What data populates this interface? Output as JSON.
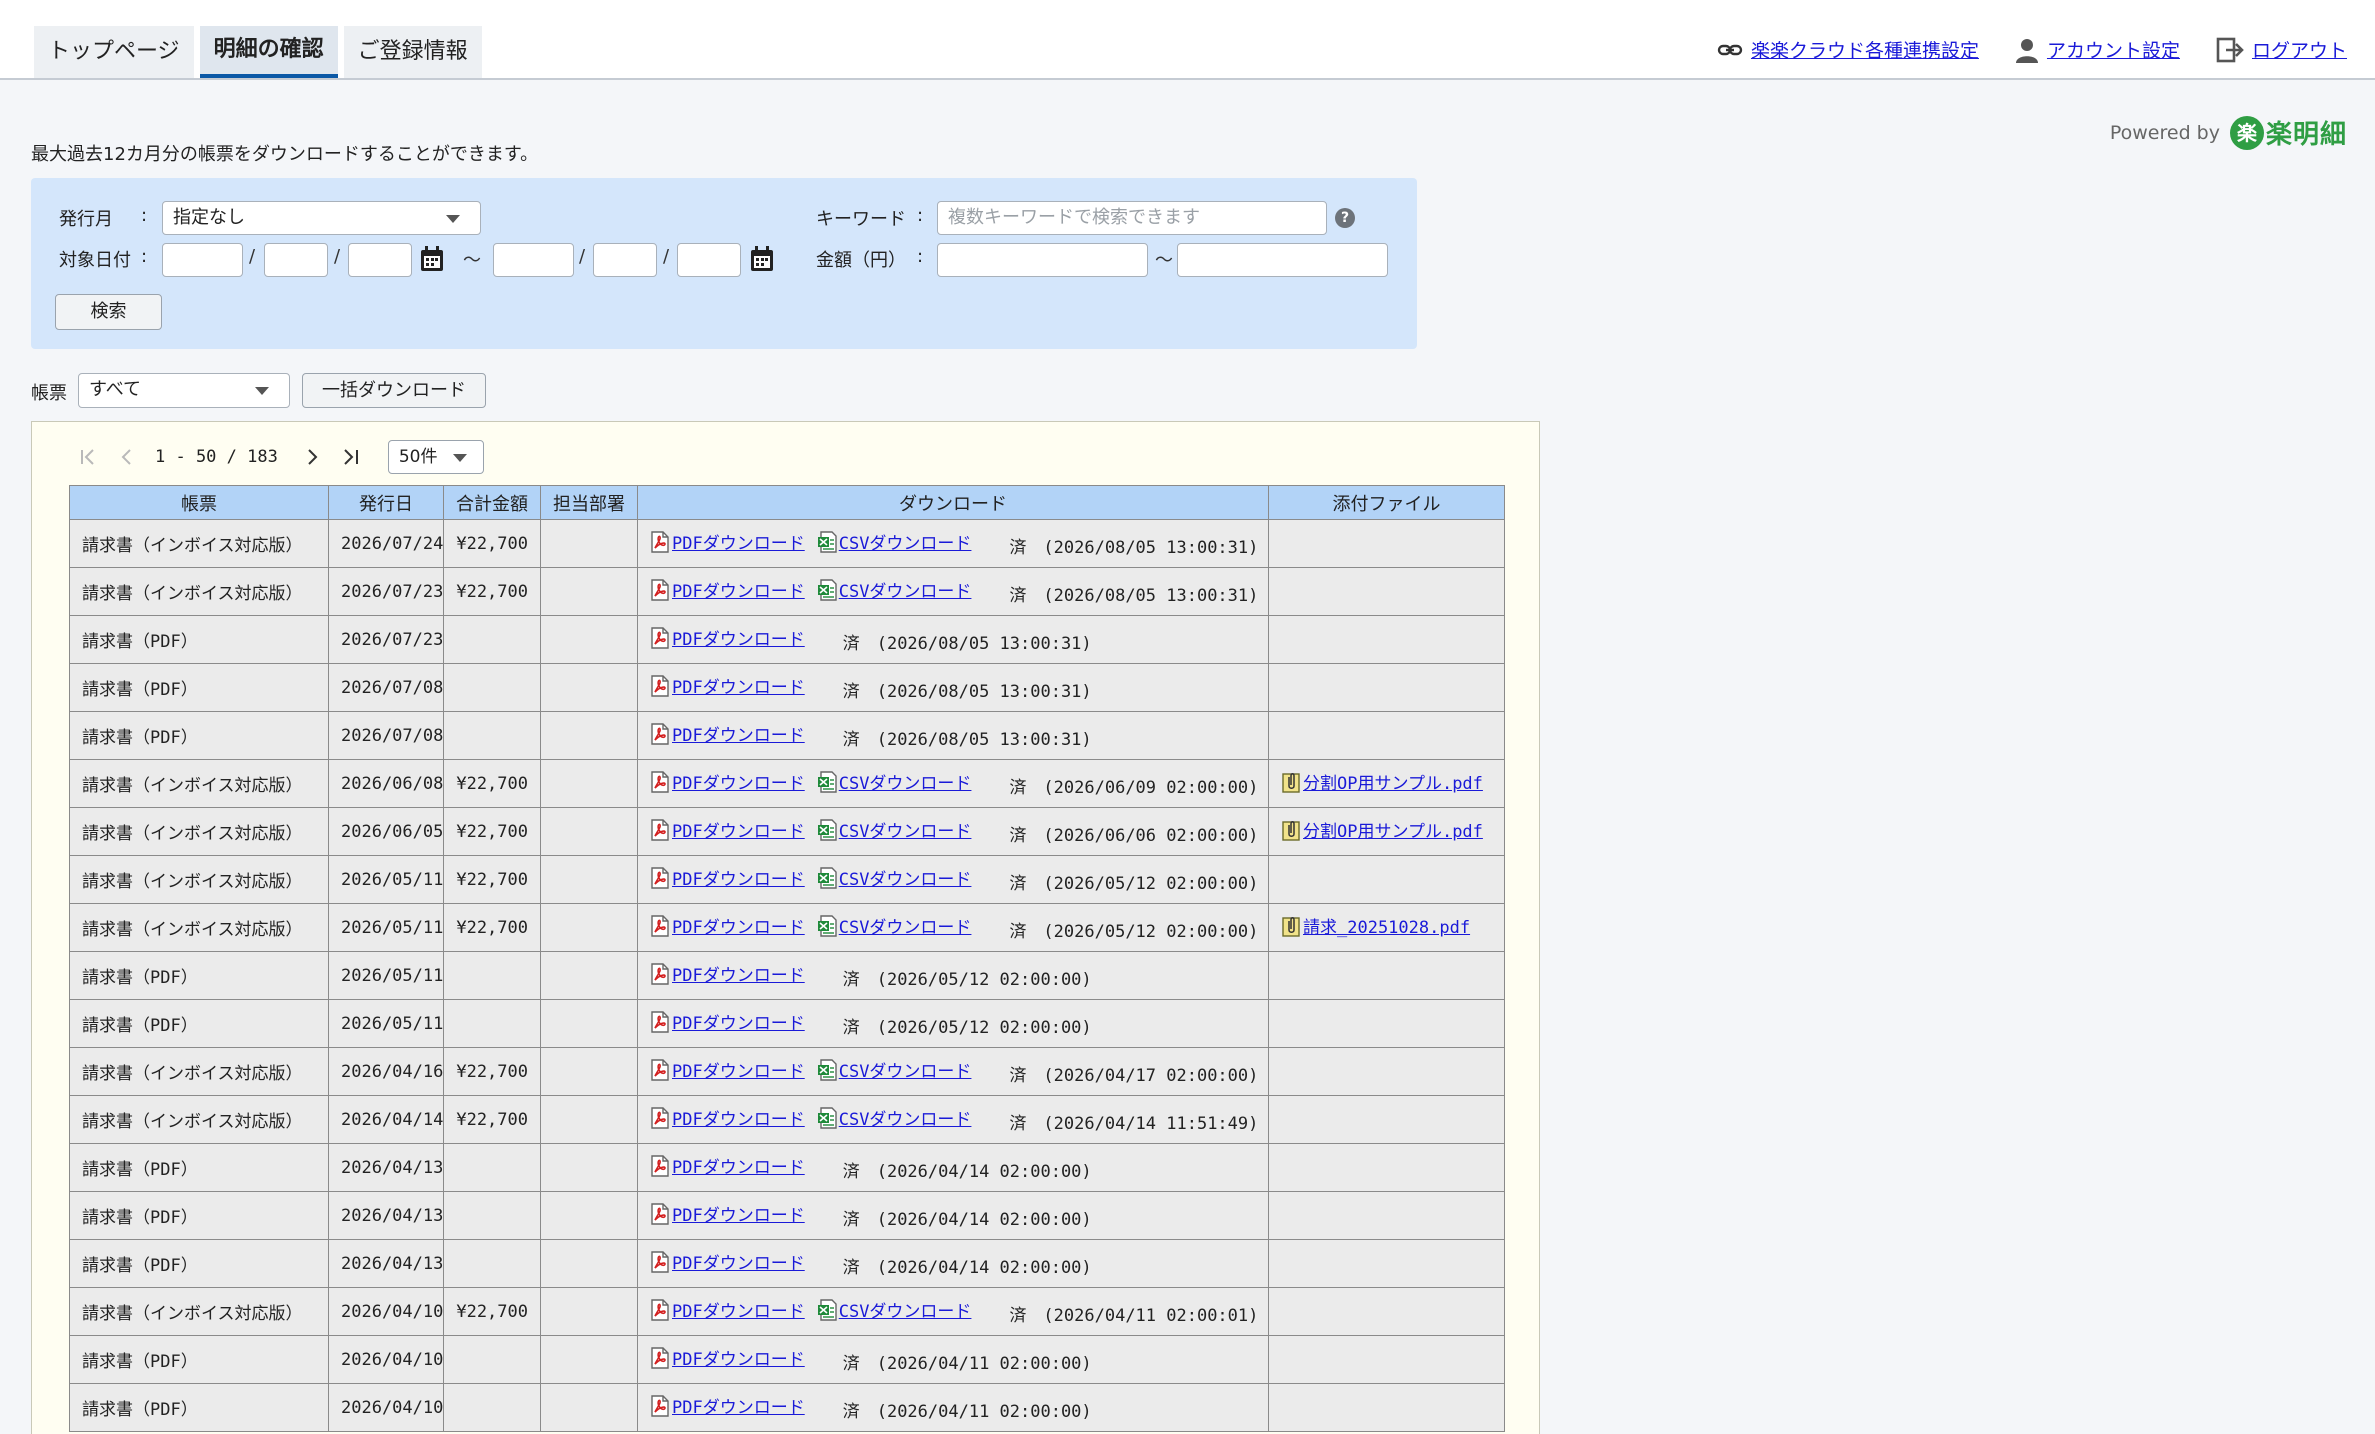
{
  "header": {
    "tabs": [
      {
        "label": "トップページ"
      },
      {
        "label": "明細の確認"
      },
      {
        "label": "ご登録情報"
      }
    ],
    "links": {
      "integration": "楽楽クラウド各種連携設定",
      "account": "アカウント設定",
      "logout": "ログアウト"
    }
  },
  "intro": "最大過去12カ月分の帳票をダウンロードすることができます。",
  "powered": {
    "prefix": "Powered by",
    "mark": "楽",
    "brand": "楽明細"
  },
  "search": {
    "issue_month_label": "発行月",
    "issue_month_value": "指定なし",
    "target_date_label": "対象日付",
    "colon": ":",
    "slash": "/",
    "tilde": "～",
    "keyword_label": "キーワード",
    "keyword_placeholder": "複数キーワードで検索できます",
    "help": "?",
    "amount_label": "金額（円）",
    "search_button": "検索"
  },
  "filter": {
    "label": "帳票",
    "value": "すべて",
    "bulk_button": "一括ダウンロード"
  },
  "pager": {
    "range": "1 - 50 / 183",
    "per_page": "50件"
  },
  "table": {
    "headers": [
      "帳票",
      "発行日",
      "合計金額",
      "担当部署",
      "ダウンロード",
      "添付ファイル"
    ],
    "pdf_label": "PDFダウンロード",
    "csv_label": "CSVダウンロード",
    "rows": [
      {
        "doc": "請求書（インボイス対応版）",
        "date": "2026/07/24",
        "amount": "¥22,700",
        "dept": "",
        "csv": true,
        "status": "済　(2026/08/05 13:00:31)",
        "attachment": ""
      },
      {
        "doc": "請求書（インボイス対応版）",
        "date": "2026/07/23",
        "amount": "¥22,700",
        "dept": "",
        "csv": true,
        "status": "済　(2026/08/05 13:00:31)",
        "attachment": ""
      },
      {
        "doc": "請求書（PDF）",
        "date": "2026/07/23",
        "amount": "",
        "dept": "",
        "csv": false,
        "status": "済　(2026/08/05 13:00:31)",
        "attachment": ""
      },
      {
        "doc": "請求書（PDF）",
        "date": "2026/07/08",
        "amount": "",
        "dept": "",
        "csv": false,
        "status": "済　(2026/08/05 13:00:31)",
        "attachment": ""
      },
      {
        "doc": "請求書（PDF）",
        "date": "2026/07/08",
        "amount": "",
        "dept": "",
        "csv": false,
        "status": "済　(2026/08/05 13:00:31)",
        "attachment": ""
      },
      {
        "doc": "請求書（インボイス対応版）",
        "date": "2026/06/08",
        "amount": "¥22,700",
        "dept": "",
        "csv": true,
        "status": "済　(2026/06/09 02:00:00)",
        "attachment": "分割OP用サンプル.pdf"
      },
      {
        "doc": "請求書（インボイス対応版）",
        "date": "2026/06/05",
        "amount": "¥22,700",
        "dept": "",
        "csv": true,
        "status": "済　(2026/06/06 02:00:00)",
        "attachment": "分割OP用サンプル.pdf"
      },
      {
        "doc": "請求書（インボイス対応版）",
        "date": "2026/05/11",
        "amount": "¥22,700",
        "dept": "",
        "csv": true,
        "status": "済　(2026/05/12 02:00:00)",
        "attachment": ""
      },
      {
        "doc": "請求書（インボイス対応版）",
        "date": "2026/05/11",
        "amount": "¥22,700",
        "dept": "",
        "csv": true,
        "status": "済　(2026/05/12 02:00:00)",
        "attachment": "請求_20251028.pdf"
      },
      {
        "doc": "請求書（PDF）",
        "date": "2026/05/11",
        "amount": "",
        "dept": "",
        "csv": false,
        "status": "済　(2026/05/12 02:00:00)",
        "attachment": ""
      },
      {
        "doc": "請求書（PDF）",
        "date": "2026/05/11",
        "amount": "",
        "dept": "",
        "csv": false,
        "status": "済　(2026/05/12 02:00:00)",
        "attachment": ""
      },
      {
        "doc": "請求書（インボイス対応版）",
        "date": "2026/04/16",
        "amount": "¥22,700",
        "dept": "",
        "csv": true,
        "status": "済　(2026/04/17 02:00:00)",
        "attachment": ""
      },
      {
        "doc": "請求書（インボイス対応版）",
        "date": "2026/04/14",
        "amount": "¥22,700",
        "dept": "",
        "csv": true,
        "status": "済　(2026/04/14 11:51:49)",
        "attachment": ""
      },
      {
        "doc": "請求書（PDF）",
        "date": "2026/04/13",
        "amount": "",
        "dept": "",
        "csv": false,
        "status": "済　(2026/04/14 02:00:00)",
        "attachment": ""
      },
      {
        "doc": "請求書（PDF）",
        "date": "2026/04/13",
        "amount": "",
        "dept": "",
        "csv": false,
        "status": "済　(2026/04/14 02:00:00)",
        "attachment": ""
      },
      {
        "doc": "請求書（PDF）",
        "date": "2026/04/13",
        "amount": "",
        "dept": "",
        "csv": false,
        "status": "済　(2026/04/14 02:00:00)",
        "attachment": ""
      },
      {
        "doc": "請求書（インボイス対応版）",
        "date": "2026/04/10",
        "amount": "¥22,700",
        "dept": "",
        "csv": true,
        "status": "済　(2026/04/11 02:00:01)",
        "attachment": ""
      },
      {
        "doc": "請求書（PDF）",
        "date": "2026/04/10",
        "amount": "",
        "dept": "",
        "csv": false,
        "status": "済　(2026/04/11 02:00:00)",
        "attachment": ""
      },
      {
        "doc": "請求書（PDF）",
        "date": "2026/04/10",
        "amount": "",
        "dept": "",
        "csv": false,
        "status": "済　(2026/04/11 02:00:00)",
        "attachment": ""
      }
    ]
  },
  "icons": {
    "link": "link-icon",
    "account": "user-icon",
    "logout": "logout-icon",
    "calendar": "calendar-icon",
    "pdf": "pdf-file-icon",
    "csv": "csv-file-icon",
    "attachment": "clip-icon"
  },
  "colors": {
    "accent": "#0a58a6",
    "link": "#1a1ad8",
    "panel": "#d4e6fb",
    "table_header": "#b2d3f7",
    "brand": "#2f9e44"
  }
}
